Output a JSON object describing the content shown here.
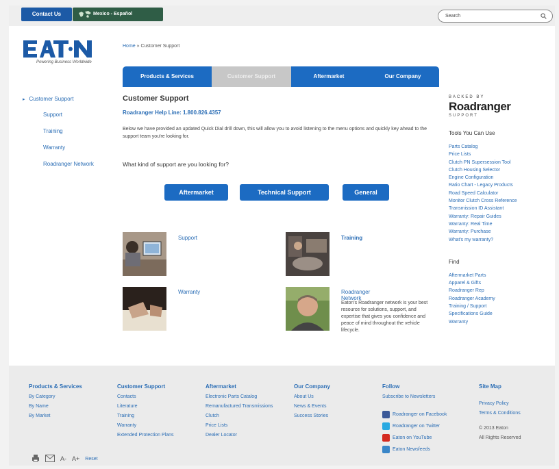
{
  "header": {
    "contact_label": "Contact Us",
    "region_label": "Mexico - Español",
    "search_placeholder": "Search"
  },
  "logo": {
    "text": "E·T·N",
    "tagline": "Powering Business Worldwide"
  },
  "breadcrumb": {
    "home": "Home",
    "separator": " » ",
    "current": "Customer Support"
  },
  "nav": {
    "tabs": [
      {
        "label": "Products & Services"
      },
      {
        "label": "Customer Support"
      },
      {
        "label": "Aftermarket"
      },
      {
        "label": "Our Company"
      }
    ]
  },
  "left_nav": {
    "heading": "Customer Support",
    "items": [
      "Support",
      "Training",
      "Warranty",
      "Roadranger Network"
    ]
  },
  "main": {
    "title": "Customer Support",
    "helpline": "Roadranger Help Line: 1.800.826.4357",
    "intro": "Below we have provided an updated Quick Dial drill down, this will allow you to avoid listening to the menu options and quickly key ahead to the support team you're looking for.",
    "question": "What kind of support are you looking for?",
    "buttons": [
      "Aftermarket",
      "Technical Support",
      "General"
    ],
    "cards": [
      {
        "title": "Support",
        "desc": ""
      },
      {
        "title": "Training",
        "desc": ""
      },
      {
        "title": "Warranty",
        "desc": ""
      },
      {
        "title": "Roadranger Network",
        "desc": "Eaton's Roadranger network is your best resource for solutions, support, and expertise that gives you confidence and peace of mind throughout the vehicle lifecycle."
      }
    ]
  },
  "right": {
    "backed_by": "BACKED BY",
    "brand": "Roadranger",
    "brand_sub": "SUPPORT",
    "tools_heading": "Tools You Can Use",
    "tools": [
      "Parts Catalog",
      "Price Lists",
      "Clutch PN Supersession Tool",
      "Clutch Housing Selector",
      "Engine Configuration",
      "Ratio Chart - Legacy Products",
      "Road Speed Calculator",
      "Monitor Clutch Cross Reference",
      "Transmission ID Assistant",
      "Warranty: Repair Guides",
      "Warranty: Real Time",
      "Warranty: Purchase",
      "What's my warranty?"
    ],
    "find_heading": "Find",
    "find": [
      "Aftermarket Parts",
      "Apparel & Gifts",
      "Roadranger Rep",
      "Roadranger Academy",
      "Training / Support",
      "Specifications Guide",
      "Warranty"
    ]
  },
  "footer": {
    "products": {
      "heading": "Products & Services",
      "links": [
        "By Category",
        "By Name",
        "By Market"
      ]
    },
    "support": {
      "heading": "Customer Support",
      "links": [
        "Contacts",
        "Literature",
        "Training",
        "Warranty",
        "Extended Protection Plans"
      ]
    },
    "aftermarket": {
      "heading": "Aftermarket",
      "links": [
        "Electronic Parts Catalog",
        "Remanufactured Transmissions",
        "Clutch",
        "Price Lists",
        "Dealer Locator"
      ]
    },
    "company": {
      "heading": "Our Company",
      "links": [
        "About Us",
        "News & Events",
        "Success Stories"
      ]
    },
    "follow": {
      "heading": "Follow",
      "newsletter": "Subscribe to Newsletters",
      "social": [
        "Roadranger on Facebook",
        "Roadranger on Twitter",
        "Eaton on YouTube",
        "Eaton Newsfeeds"
      ]
    },
    "sitemap": {
      "heading": "Site Map",
      "links": [
        "Privacy Policy",
        "Terms & Conditions"
      ],
      "copyright": "© 2013 Eaton",
      "rights": "All Rights Reserved"
    },
    "tools": {
      "a_minus": "A-",
      "a_plus": "A+",
      "reset": "Reset"
    }
  },
  "colors": {
    "brand_blue": "#1c6bc2",
    "link_blue": "#2a6db5",
    "region_green": "#2f5d46",
    "active_tab": "#c7c7c7"
  }
}
